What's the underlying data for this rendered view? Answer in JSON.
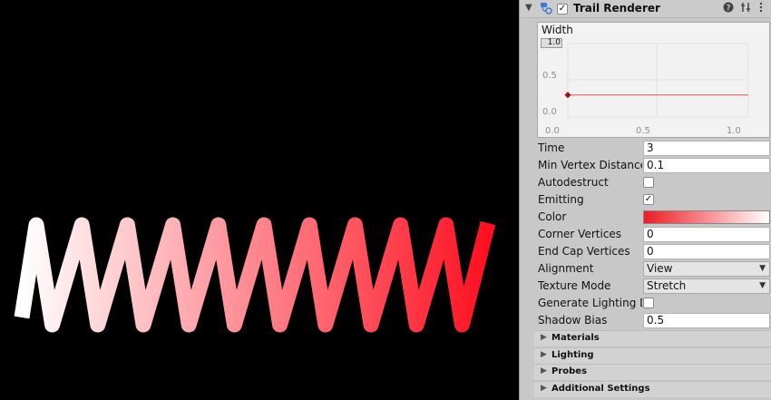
{
  "component": {
    "title": "Trail Renderer",
    "enabled": true,
    "icons": {
      "fold": "chevron-down-icon",
      "component": "trail-renderer-icon",
      "help": "help-icon",
      "presets": "presets-icon",
      "menu": "kebab-menu-icon"
    }
  },
  "width_curve": {
    "title": "Width",
    "y_max_value": "1.0",
    "y_mid": "0.5",
    "y_min": "0.0",
    "x_min": "0.0",
    "x_mid": "0.5",
    "x_max": "1.0",
    "key_value": 0.3,
    "curve_color": "#d9534f"
  },
  "properties": {
    "time": {
      "label": "Time",
      "value": "3"
    },
    "min_vertex_distance": {
      "label": "Min Vertex Distance",
      "value": "0.1"
    },
    "autodestruct": {
      "label": "Autodestruct",
      "checked": false
    },
    "emitting": {
      "label": "Emitting",
      "checked": true,
      "check_glyph": "✓"
    },
    "color": {
      "label": "Color",
      "gradient_start": "#ee1c24",
      "gradient_end": "#ffffff"
    },
    "corner_vertices": {
      "label": "Corner Vertices",
      "value": "0"
    },
    "end_cap_vertices": {
      "label": "End Cap Vertices",
      "value": "0"
    },
    "alignment": {
      "label": "Alignment",
      "value": "View"
    },
    "texture_mode": {
      "label": "Texture Mode",
      "value": "Stretch"
    },
    "generate_lighting_data": {
      "label": "Generate Lighting Data",
      "checked": false
    },
    "shadow_bias": {
      "label": "Shadow Bias",
      "value": "0.5"
    }
  },
  "sections": [
    "Materials",
    "Lighting",
    "Probes",
    "Additional Settings"
  ],
  "scene": {
    "trail_start_color": "#ffffff",
    "trail_end_color": "#ff1020",
    "background": "#000000"
  }
}
